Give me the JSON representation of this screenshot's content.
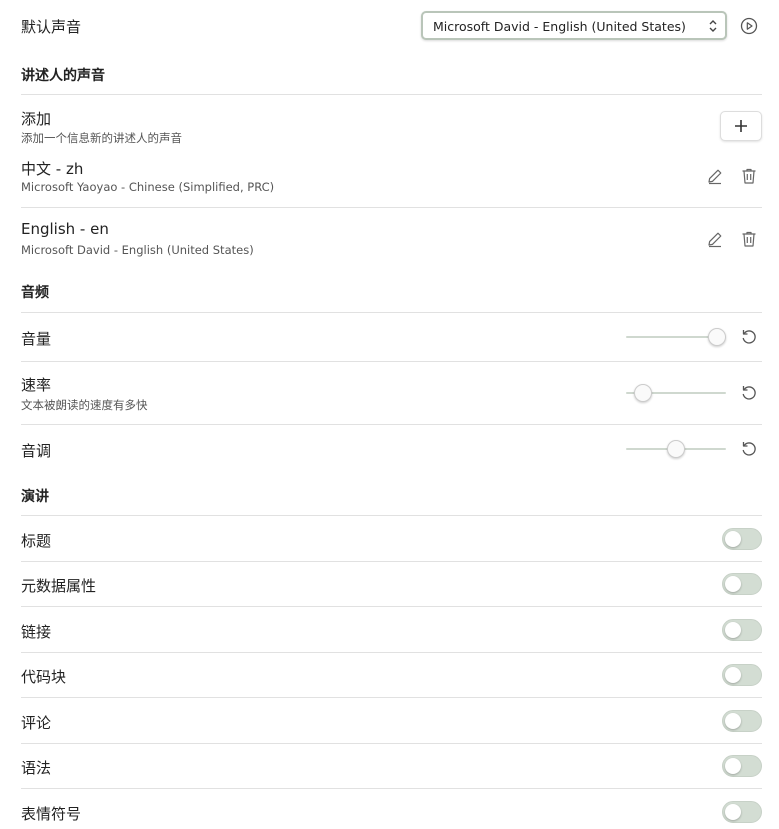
{
  "default_voice": {
    "label": "默认声音",
    "selected": "Microsoft David - English (United States)",
    "play_icon": "play-circle-icon"
  },
  "narrator_section": {
    "heading": "讲述人的声音",
    "add": {
      "label": "添加",
      "description": "添加一个信息新的讲述人的声音",
      "button_icon": "plus-icon"
    },
    "voices": [
      {
        "name": "中文 - zh",
        "voice": "Microsoft Yaoyao - Chinese (Simplified, PRC)"
      },
      {
        "name": "English - en",
        "voice": "Microsoft David - English (United States)"
      }
    ]
  },
  "audio_section": {
    "heading": "音频",
    "volume": {
      "label": "音量",
      "value": 0.91
    },
    "rate": {
      "label": "速率",
      "description": "文本被朗读的速度有多快",
      "value": 0.17
    },
    "pitch": {
      "label": "音调",
      "value": 0.5
    }
  },
  "speech_section": {
    "heading": "演讲",
    "toggles": [
      {
        "label": "标题",
        "on": false
      },
      {
        "label": "元数据属性",
        "on": false
      },
      {
        "label": "链接",
        "on": false
      },
      {
        "label": "代码块",
        "on": false
      },
      {
        "label": "评论",
        "on": false
      },
      {
        "label": "语法",
        "on": false
      },
      {
        "label": "表情符号",
        "on": false
      }
    ]
  },
  "colors": {
    "accent_border": "#b9c5b9",
    "toggle_off": "#d3ddd3",
    "icon": "#666666"
  }
}
